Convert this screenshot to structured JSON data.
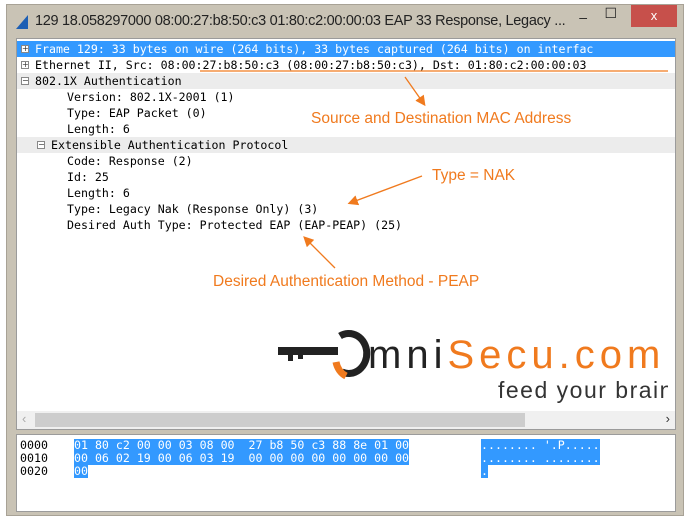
{
  "window": {
    "title": "129 18.058297000 08:00:27:b8:50:c3 01:80:c2:00:00:03 EAP 33 Response, Legacy ...",
    "minimize": "–",
    "maximize": "☐",
    "close": "x"
  },
  "tree": [
    {
      "text": "Frame 129: 33 bytes on wire (264 bits), 33 bytes captured (264 bits) on interfac",
      "expander": "+"
    },
    {
      "text": "Ethernet II, Src: 08:00:27:b8:50:c3 (08:00:27:b8:50:c3), Dst: 01:80:c2:00:00:03",
      "expander": "+"
    },
    {
      "text": "802.1X Authentication",
      "expander": "−"
    },
    {
      "text": "Version: 802.1X-2001 (1)"
    },
    {
      "text": "Type: EAP Packet (0)"
    },
    {
      "text": "Length: 6"
    },
    {
      "text": "Extensible Authentication Protocol",
      "expander": "−"
    },
    {
      "text": "Code: Response (2)"
    },
    {
      "text": "Id: 25"
    },
    {
      "text": "Length: 6"
    },
    {
      "text": "Type: Legacy Nak (Response Only) (3)"
    },
    {
      "text": "Desired Auth Type: Protected EAP (EAP-PEAP) (25)"
    }
  ],
  "hex": [
    {
      "offset": "0000",
      "bytes": "01 80 c2 00 00 03 08 00  27 b8 50 c3 88 8e 01 00",
      "ascii": "........ '.P....."
    },
    {
      "offset": "0010",
      "bytes": "00 06 02 19 00 06 03 19  00 00 00 00 00 00 00 00",
      "ascii": "........ ........"
    },
    {
      "offset": "0020",
      "bytes": "00",
      "ascii": "."
    }
  ],
  "annotations": {
    "mac": "Source and Destination MAC Address",
    "nak": "Type = NAK",
    "peap": "Desired Authentication Method - PEAP"
  },
  "logo": {
    "text": "OmniSecu.com",
    "tagline": "feed your brain"
  },
  "scroll": {
    "left": "‹",
    "right": "›"
  },
  "colors": {
    "selection": "#3399ff",
    "annotation": "#f07a1e"
  }
}
